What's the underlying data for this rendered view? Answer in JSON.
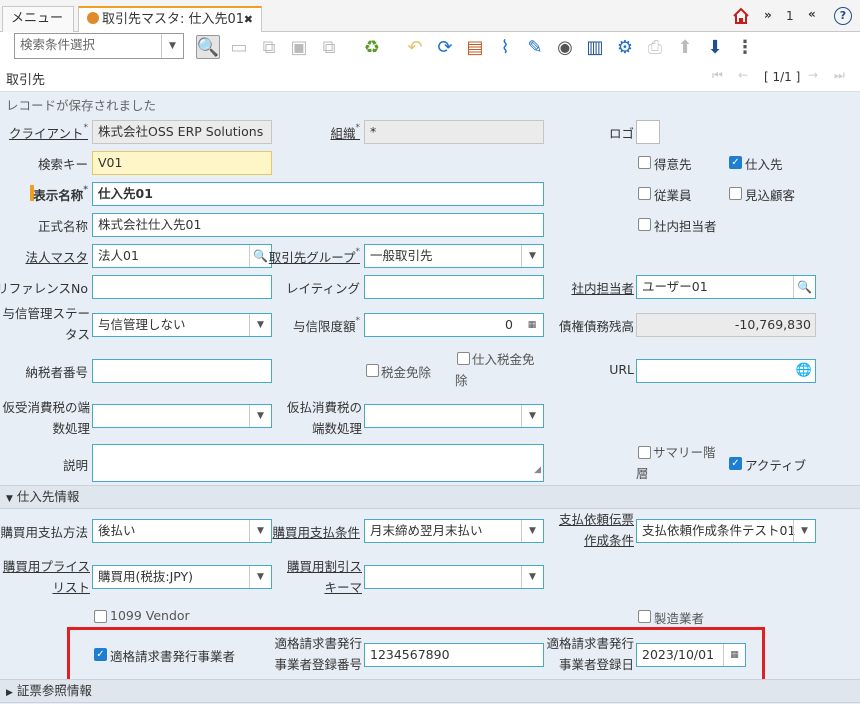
{
  "tabs": [
    {
      "label": "メニュー"
    },
    {
      "label": "取引先マスタ: 仕入先01",
      "close": "✖"
    }
  ],
  "tabbar_right": {
    "count": "1"
  },
  "toolbar": {
    "search_placeholder": "検索条件選択"
  },
  "title": {
    "label": "取引先",
    "record_nav": "[ 1/1 ]"
  },
  "status_message": "レコードが保存されました",
  "form": {
    "client_label": "クライアント",
    "client_value": "株式会社OSS ERP Solutions",
    "org_label": "組織",
    "org_value": "*",
    "logo_label": "ロゴ",
    "search_key_label": "検索キー",
    "search_key_value": "V01",
    "display_name_label": "表示名称",
    "display_name_value": "仕入先01",
    "official_name_label": "正式名称",
    "official_name_value": "株式会社仕入先01",
    "corp_master_label": "法人マスタ",
    "corp_master_value": "法人01",
    "partner_group_label": "取引先グループ",
    "partner_group_value": "一般取引先",
    "reference_no_label": "リファレンスNo",
    "reference_no_value": "",
    "rating_label": "レイティング",
    "rating_value": "",
    "internal_rep_label": "社内担当者",
    "internal_rep_value": "ユーザー01",
    "credit_status_label": "与信管理ステータス",
    "credit_status_value": "与信管理しない",
    "credit_limit_label": "与信限度額",
    "credit_limit_value": "0",
    "balance_label": "債権債務残高",
    "balance_value": "-10,769,830",
    "tax_id_label": "納税者番号",
    "tax_id_value": "",
    "tax_exempt_label": "税金免除",
    "po_tax_exempt_label": "仕入税金免除",
    "url_label": "URL",
    "url_value": "",
    "so_tax_rounding_label": "仮受消費税の端数処理",
    "so_tax_rounding_value": "",
    "po_tax_rounding_label": "仮払消費税の端数処理",
    "po_tax_rounding_value": "",
    "description_label": "説明",
    "description_value": "",
    "customer_label": "得意先",
    "customer_checked": false,
    "vendor_label": "仕入先",
    "vendor_checked": true,
    "employee_label": "従業員",
    "employee_checked": false,
    "prospect_label": "見込顧客",
    "prospect_checked": false,
    "internal_rep_flag_label": "社内担当者",
    "internal_rep_flag_checked": false,
    "summary_label": "サマリー階層",
    "summary_checked": false,
    "active_label": "アクティブ",
    "active_checked": true
  },
  "vendor_section": {
    "header": "仕入先情報",
    "payment_rule_label": "購買用支払方法",
    "payment_rule_value": "後払い",
    "payment_term_label": "購買用支払条件",
    "payment_term_value": "月末締め翌月末払い",
    "payment_request_label": "支払依頼伝票作成条件",
    "payment_request_value": "支払依頼作成条件テスト01",
    "price_list_label": "購買用プライスリスト",
    "price_list_value": "購買用(税抜:JPY)",
    "discount_schema_label": "購買用割引スキーマ",
    "discount_schema_value": "",
    "vendor1099_label": "1099 Vendor",
    "vendor1099_checked": false,
    "manufacturer_label": "製造業者",
    "manufacturer_checked": false,
    "invoice_issuer_label": "適格請求書発行事業者",
    "invoice_issuer_checked": true,
    "reg_number_label": "適格請求書発行事業者登録番号",
    "reg_number_value": "1234567890",
    "reg_date_label": "適格請求書発行事業者登録日",
    "reg_date_value": "2023/10/01"
  },
  "collapsed_section": {
    "header": "証票参照情報"
  },
  "colors": {
    "accent": "#48a8c8",
    "highlight_border": "#e02020",
    "tab_accent": "#f0a020",
    "toolbar_blue": "#1f6fc8"
  }
}
